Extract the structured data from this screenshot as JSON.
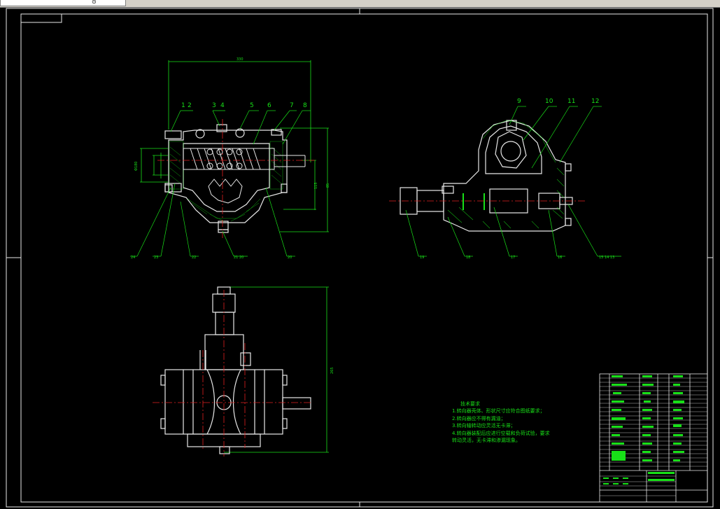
{
  "window": {
    "tab_glyph": "⊙"
  },
  "drawing": {
    "technical_requirements": {
      "title": "技术要求",
      "items": [
        "1.转向器壳体、形状尺寸应符合图纸要求；",
        "2.转向器应不得有漏油；",
        "3.转向轴转动应灵活无卡滞；",
        "4.转向器装配后应进行空载和负荷试验，要求",
        "  转动灵活，无卡滞和渗漏现象。"
      ]
    },
    "balloons_front": [
      "1",
      "2",
      "3",
      "4",
      "5",
      "6",
      "7",
      "8"
    ],
    "balloons_side": [
      "9",
      "10",
      "11",
      "12"
    ],
    "balloons_front_bottom": [
      "24",
      "23",
      "22",
      "21  20",
      "20"
    ],
    "balloons_side_bottom": [
      "19",
      "18",
      "17",
      "16",
      "15  14  13"
    ],
    "dims_front": [
      "Φ180",
      "115",
      "85",
      "330"
    ],
    "dim_plan": "265"
  }
}
